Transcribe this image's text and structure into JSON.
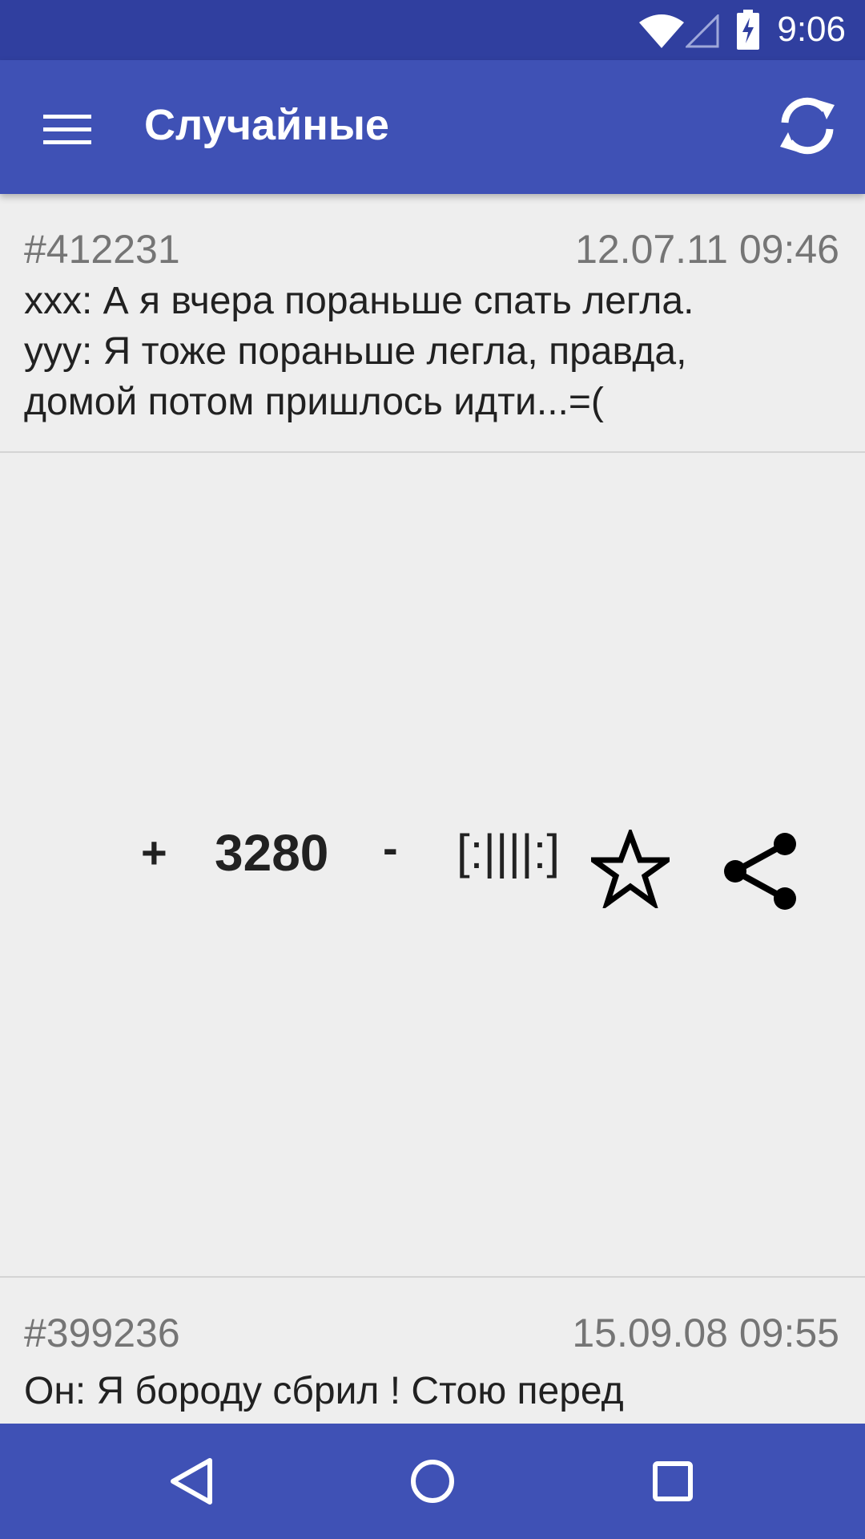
{
  "status_bar": {
    "time": "9:06",
    "icons": [
      "wifi-icon",
      "cell-signal-icon",
      "battery-charging-icon"
    ]
  },
  "app_bar": {
    "title": "Случайные",
    "menu_icon": "hamburger-menu-icon",
    "refresh_icon": "refresh-icon"
  },
  "quotes": [
    {
      "id": "#412231",
      "date": "12.07.11 09:46",
      "text": "xxx: А я вчера пораньше спать легла.\nууу: Я тоже пораньше легла, правда,\nдомой потом пришлось идти...=(",
      "score": "3280",
      "plus": "+",
      "minus": "-",
      "bayan": "[:||||:]"
    },
    {
      "id": "#399236",
      "date": "15.09.08 09:55",
      "text": "Он: Я бороду сбрил ! Стою перед"
    }
  ],
  "nav_bar": {
    "icons": [
      "back-icon",
      "home-icon",
      "recents-icon"
    ]
  },
  "colors": {
    "status_bar": "#303f9f",
    "app_bar": "#3f51b5",
    "background": "#eeeeee"
  }
}
